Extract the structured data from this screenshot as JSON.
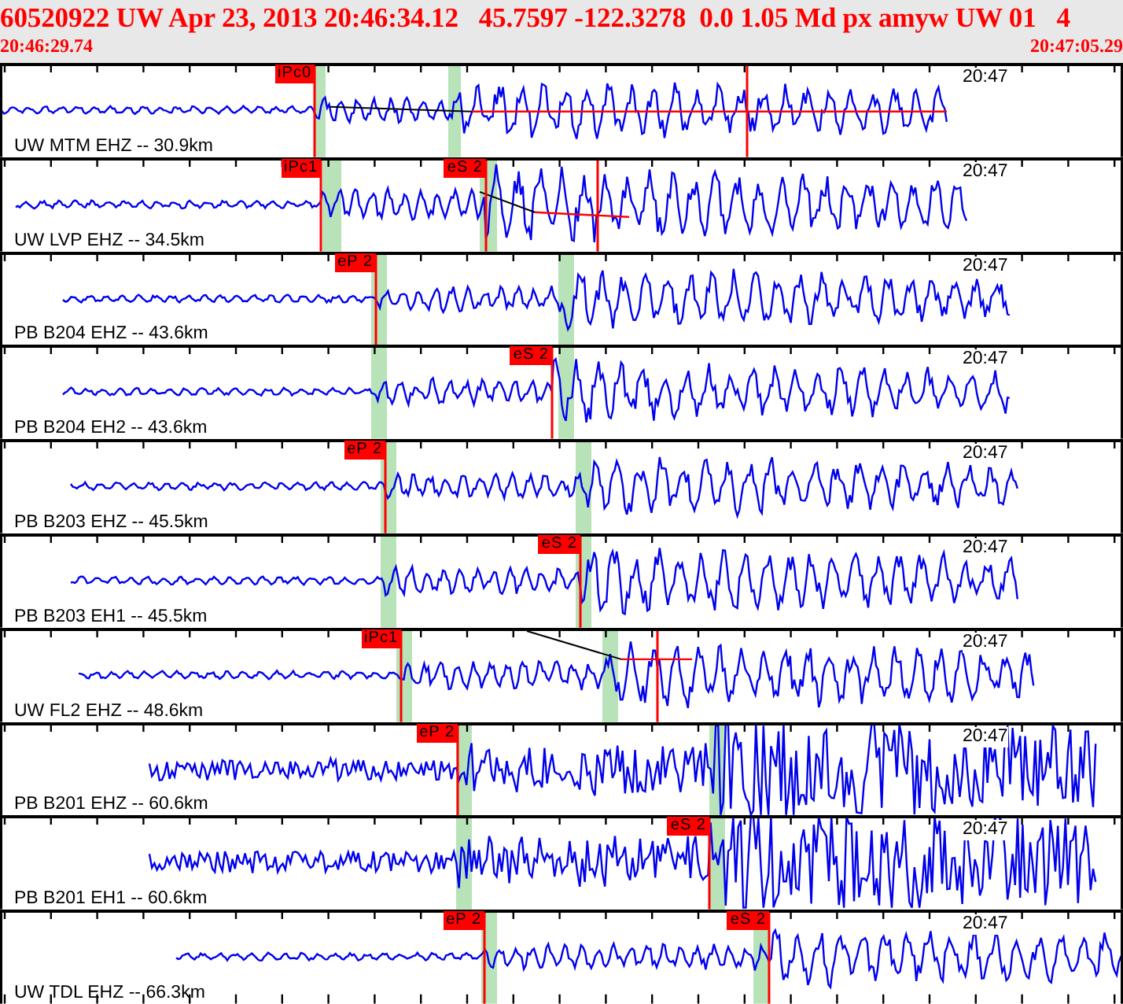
{
  "header": {
    "title": "60520922 UW Apr 23, 2013 20:46:34.12   45.7597 -122.3278  0.0 1.05 Md px amyw UW 01   4",
    "start_time": "20:46:29.74",
    "end_time": "20:47:05.29"
  },
  "traces": [
    {
      "station": "UW MTM EHZ -- 30.9km",
      "time": "20:47",
      "picks": [
        "iPc0"
      ]
    },
    {
      "station": "UW LVP EHZ -- 34.5km",
      "time": "20:47",
      "picks": [
        "iPc1",
        "eS 2"
      ]
    },
    {
      "station": "PB B204 EHZ -- 43.6km",
      "time": "20:47",
      "picks": [
        "eP 2"
      ]
    },
    {
      "station": "PB B204 EH2 -- 43.6km",
      "time": "20:47",
      "picks": [
        "eS 2"
      ]
    },
    {
      "station": "PB B203 EHZ -- 45.5km",
      "time": "20:47",
      "picks": [
        "eP 2"
      ]
    },
    {
      "station": "PB B203 EH1 -- 45.5km",
      "time": "20:47",
      "picks": [
        "eS 2"
      ]
    },
    {
      "station": "UW FL2 EHZ -- 48.6km",
      "time": "20:47",
      "picks": [
        "iPc1"
      ]
    },
    {
      "station": "PB B201 EHZ -- 60.6km",
      "time": "20:47",
      "picks": [
        "eP 2"
      ]
    },
    {
      "station": "PB B201 EH1 -- 60.6km",
      "time": "20:47",
      "picks": [
        "eS 2"
      ]
    },
    {
      "station": "UW TDL EHZ -- 66.3km",
      "time": "20:47",
      "picks": [
        "eP 2",
        "eS 2"
      ]
    }
  ]
}
